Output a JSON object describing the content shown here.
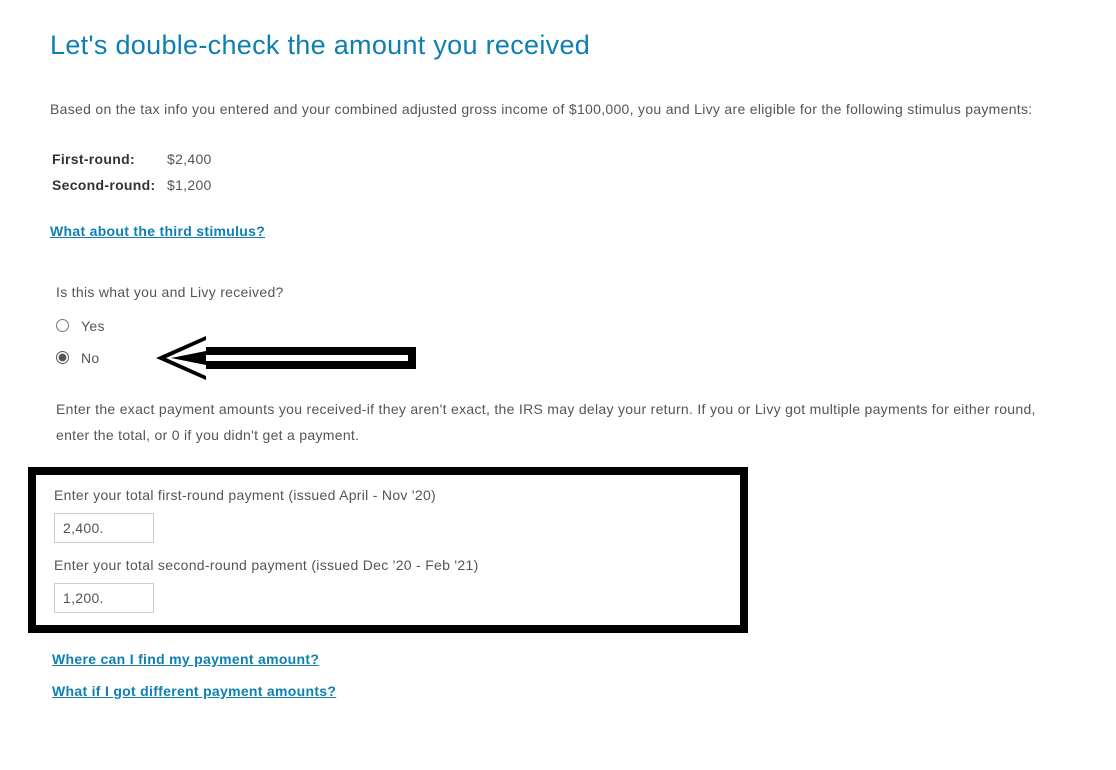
{
  "title": "Let's double-check the amount you received",
  "intro": "Based on the tax info you entered and your combined adjusted gross income of $100,000, you and Livy are eligible for the following stimulus payments:",
  "rounds": {
    "first": {
      "label": "First-round:",
      "value": "$2,400"
    },
    "second": {
      "label": "Second-round:",
      "value": "$1,200"
    }
  },
  "link_third": "What about the third stimulus?",
  "question": "Is this what you and Livy received?",
  "options": {
    "yes": "Yes",
    "no": "No"
  },
  "instruction": "Enter the exact payment amounts you received-if they aren't exact, the IRS may delay your return. If you or Livy got multiple payments for either round, enter the total, or 0 if you didn't get a payment.",
  "inputs": {
    "first": {
      "label": "Enter your total first-round payment (issued April - Nov '20)",
      "value": "2,400."
    },
    "second": {
      "label": "Enter your total second-round payment (issued Dec '20 - Feb '21)",
      "value": "1,200."
    }
  },
  "link_find": "Where can I find my payment amount?",
  "link_diff": "What if I got different payment amounts?"
}
